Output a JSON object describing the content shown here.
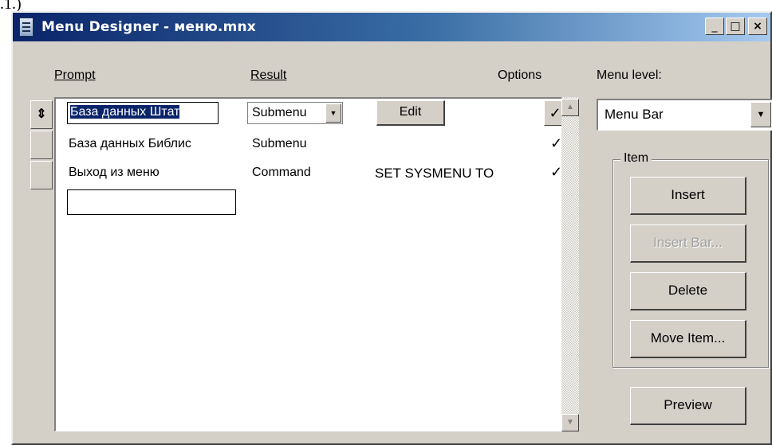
{
  "corner_text": ".1.)",
  "window": {
    "title": "Menu Designer - меню.mnx",
    "buttons": {
      "minimize": "_",
      "maximize": "□",
      "close": "×"
    }
  },
  "columns": {
    "prompt": "Prompt",
    "result": "Result",
    "options": "Options"
  },
  "rows": [
    {
      "prompt": "База данных Штат",
      "result": "Submenu",
      "command": "",
      "option_mark": "✓"
    },
    {
      "prompt": "База данных Библис",
      "result": "Submenu",
      "command": "",
      "option_mark": "✓"
    },
    {
      "prompt": "Выход из меню",
      "result": "Command",
      "command": "SET SYSMENU TO",
      "option_mark": "✓"
    }
  ],
  "edit_button": "Edit",
  "mover_icon": "up-down-arrows-icon",
  "menu_level": {
    "label": "Menu level:",
    "value": "Menu Bar"
  },
  "item_group": {
    "label": "Item",
    "insert": "Insert",
    "insert_bar": "Insert Bar...",
    "delete": "Delete",
    "move_item": "Move Item..."
  },
  "preview": "Preview",
  "colors": {
    "title_start": "#0a246a",
    "title_end": "#a6caf0",
    "face": "#d4d0c8",
    "selection": "#0a246a"
  }
}
